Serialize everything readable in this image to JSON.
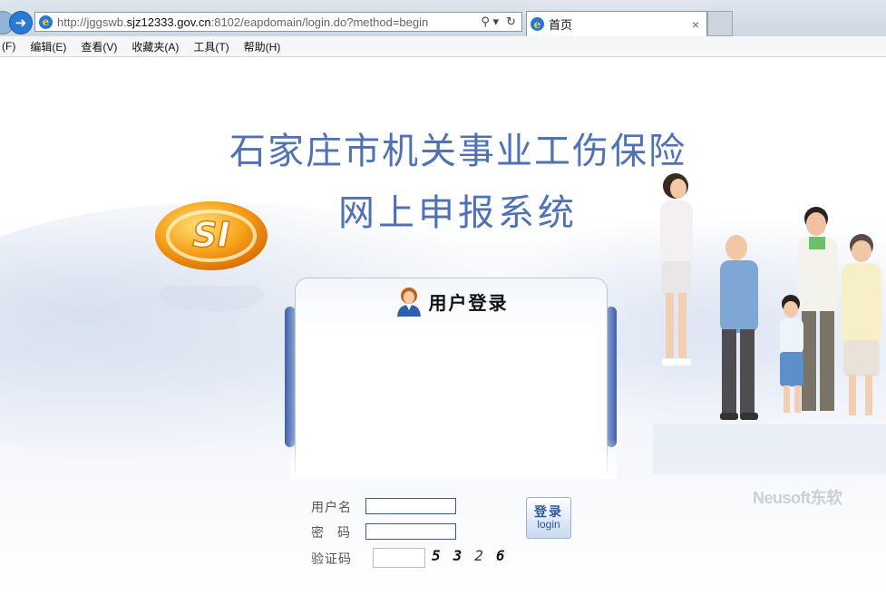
{
  "browser": {
    "url_prefix": "http://jggswb.",
    "url_domain": "sjz12333.gov.cn",
    "url_suffix": ":8102/eapdomain/login.do?method=begin",
    "tab_title": "首页",
    "tab_close": "×",
    "search_glyph": "⚲ ▾",
    "refresh_glyph": "↻"
  },
  "menu": {
    "items": [
      "(F)",
      "编辑(E)",
      "查看(V)",
      "收藏夹(A)",
      "工具(T)",
      "帮助(H)"
    ]
  },
  "page": {
    "title_line1": "石家庄市机关事业工伤保险",
    "title_line2": "网上申报系统",
    "logo_text": "SI",
    "panel_title": "用户登录",
    "labels": {
      "username": "用户名",
      "password_1": "密",
      "password_2": "码",
      "captcha": "验证码"
    },
    "fields": {
      "username_value": "",
      "password_value": "",
      "captcha_value": ""
    },
    "captcha_chars": [
      "5",
      "3",
      "2",
      "6"
    ],
    "login_button_zh": "登录",
    "login_button_en": "login",
    "brand_text": "Neusoft东软"
  },
  "colors": {
    "title": "#4f71b8",
    "accent": "#3f5fa8",
    "logo_orange": "#f59a1b"
  }
}
